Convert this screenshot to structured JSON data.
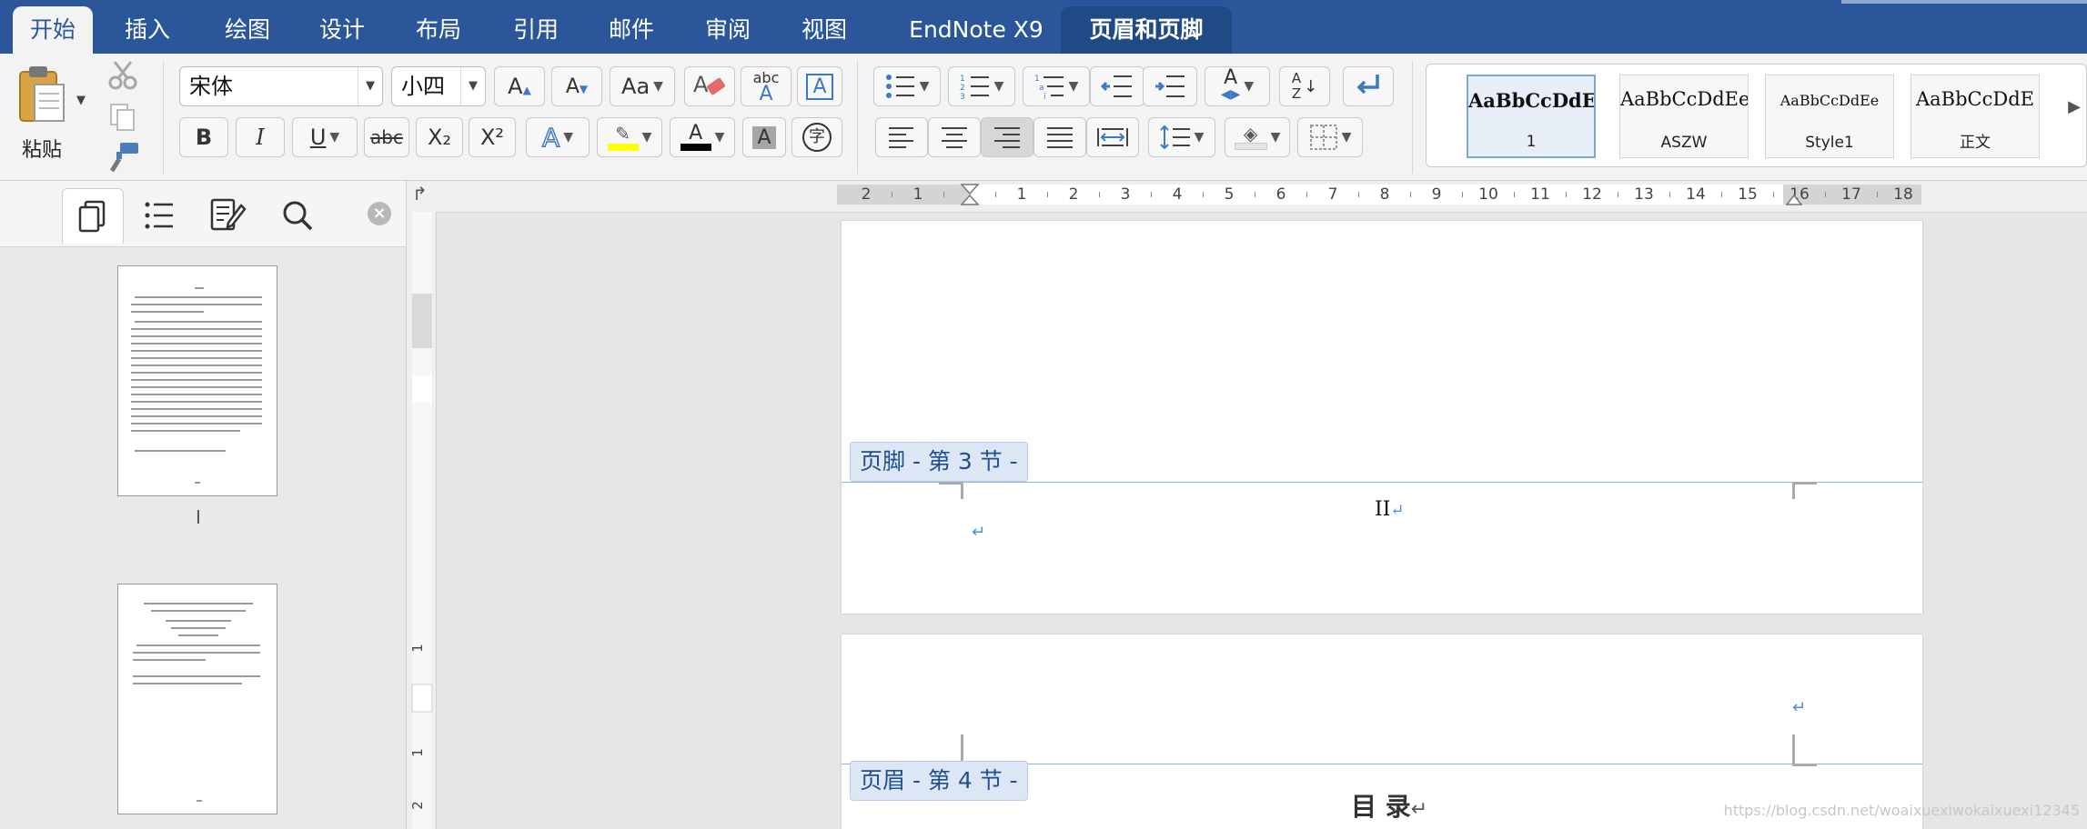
{
  "tabs": [
    {
      "label": "开始",
      "state": "active"
    },
    {
      "label": "插入"
    },
    {
      "label": "绘图"
    },
    {
      "label": "设计"
    },
    {
      "label": "布局"
    },
    {
      "label": "引用"
    },
    {
      "label": "邮件"
    },
    {
      "label": "审阅"
    },
    {
      "label": "视图"
    },
    {
      "label": "EndNote X9"
    },
    {
      "label": "页眉和页脚",
      "state": "context"
    }
  ],
  "clipboard": {
    "paste_label": "粘贴"
  },
  "font": {
    "name": "宋体",
    "size": "小四"
  },
  "icons": {
    "grow_font": "A▲",
    "shrink_font": "A▼",
    "change_case": "Aa",
    "clear_format": "eraser-icon",
    "abc_label": "abc",
    "char_border": "A",
    "bold": "B",
    "italic": "I",
    "underline": "U",
    "strike": "abc",
    "subscript": "X₂",
    "superscript": "X²",
    "text_effects": "A",
    "highlight": "✎",
    "font_color": "A",
    "char_shading": "A",
    "enclosed": "字",
    "sort_a": "A",
    "sort_z": "Z"
  },
  "colors": {
    "brand_blue": "#2b579a",
    "highlight": "#ffff00",
    "font_color": "#000000",
    "hf_tag_bg": "#dce6f4",
    "hf_text": "#1f4f8f"
  },
  "styles": [
    {
      "sample": "AaBbCcDdE",
      "name": "1",
      "selected": true
    },
    {
      "sample": "AaBbCcDdEe",
      "name": "ASZW"
    },
    {
      "sample": "AaBbCcDdEe",
      "name": "Style1"
    },
    {
      "sample": "AaBbCcDdE",
      "name": "正文"
    }
  ],
  "nav": {
    "page_labels": [
      "I"
    ]
  },
  "ruler": {
    "ticks": [
      "2",
      "1",
      "",
      "1",
      "2",
      "3",
      "4",
      "5",
      "6",
      "7",
      "8",
      "9",
      "10",
      "11",
      "12",
      "13",
      "14",
      "15",
      "16",
      "17",
      "18"
    ],
    "vticks": [
      "1",
      "",
      "1",
      "2"
    ]
  },
  "document": {
    "footer_tag": "页脚 - 第 3 节 -",
    "page_number": "II",
    "header_tag": "页眉 - 第 4 节 -",
    "toc_title": "目 录",
    "para_mark": "↵"
  },
  "watermark": "https://blog.csdn.net/woaixuexiwokaixuexi12345"
}
